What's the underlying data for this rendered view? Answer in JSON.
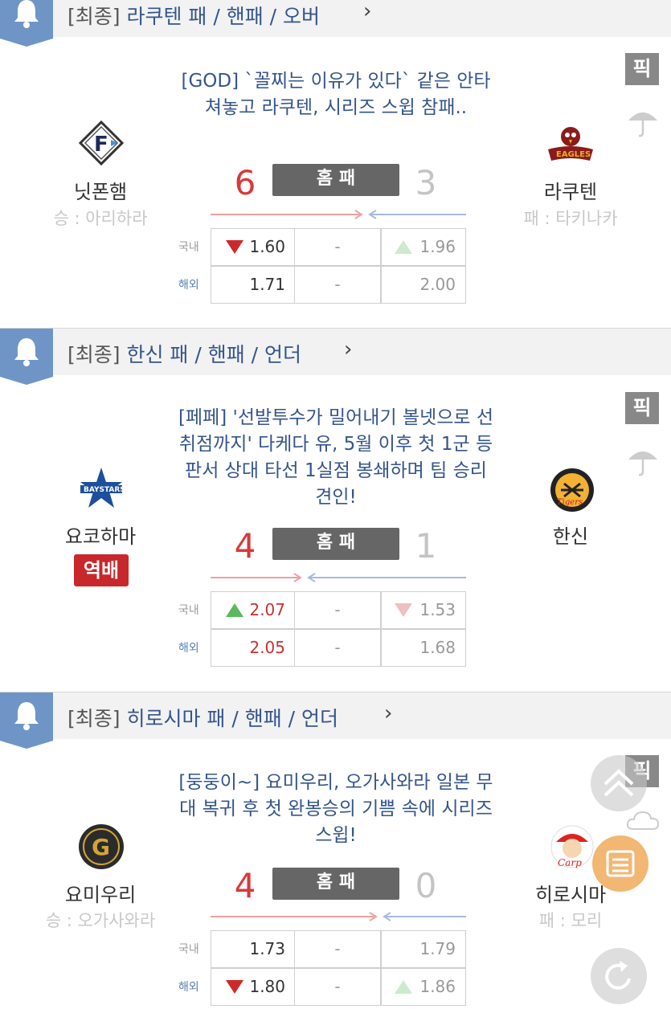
{
  "games": [
    {
      "header": {
        "prefix": "[최종]",
        "text": " 라쿠텐 패 / 핸패 / 오버",
        "chevron": "›"
      },
      "pick_label": "픽",
      "weather_icon": "umbrella-icon",
      "comment": "[GOD] `꼴찌는 이유가 있다` 같은 안타쳐놓고 라쿠텐, 시리즈 스윕 참패..",
      "home": {
        "name": "닛폰햄",
        "pitcher": "승 : 아리하라",
        "score": "6",
        "logo_icon": "fighters-logo"
      },
      "away": {
        "name": "라쿠텐",
        "pitcher": "패 : 타키나카",
        "score": "3",
        "logo_icon": "eagles-logo"
      },
      "status": "홈 패",
      "odds": [
        {
          "label": "국내",
          "home": "1.60",
          "draw": "-",
          "away": "1.96",
          "home_trend": "down",
          "away_trend": "up"
        },
        {
          "label": "해외",
          "home": "1.71",
          "draw": "-",
          "away": "2.00"
        }
      ]
    },
    {
      "header": {
        "prefix": "[최종]",
        "text": " 한신 패 / 핸패 / 언더",
        "chevron": "›"
      },
      "pick_label": "픽",
      "weather_icon": "umbrella-icon",
      "comment": "[페페] '선발투수가 밀어내기 볼넷으로 선취점까지' 다케다 유, 5월 이후 첫 1군 등판서 상대 타선 1실점 봉쇄하며 팀 승리 견인!",
      "home": {
        "name": "요코하마",
        "badge": "역배",
        "score": "4",
        "logo_icon": "baystars-logo"
      },
      "away": {
        "name": "한신",
        "score": "1",
        "logo_icon": "tigers-logo"
      },
      "status": "홈 패",
      "odds": [
        {
          "label": "국내",
          "home": "2.07",
          "draw": "-",
          "away": "1.53",
          "home_trend": "up",
          "away_trend": "down"
        },
        {
          "label": "해외",
          "home": "2.05",
          "draw": "-",
          "away": "1.68"
        }
      ]
    },
    {
      "header": {
        "prefix": "[최종]",
        "text": " 히로시마 패 / 핸패 / 언더",
        "chevron": "›"
      },
      "pick_label": "픽",
      "weather_icon": "cloud-icon",
      "comment": "[둥둥이~] 요미우리, 오가사와라 일본 무대 복귀 후 첫 완봉승의 기쁨 속에 시리즈 스윕!",
      "home": {
        "name": "요미우리",
        "pitcher": "승 : 오가사와라",
        "score": "4",
        "logo_icon": "giants-logo"
      },
      "away": {
        "name": "히로시마",
        "pitcher": "패 : 모리",
        "score": "0",
        "logo_icon": "carp-logo"
      },
      "status": "홈 패",
      "odds": [
        {
          "label": "국내",
          "home": "1.73",
          "draw": "-",
          "away": "1.79"
        },
        {
          "label": "해외",
          "home": "1.80",
          "draw": "-",
          "away": "1.86",
          "home_trend": "down",
          "away_trend": "up"
        }
      ]
    }
  ],
  "colors": {
    "accent_blue": "#34558b",
    "win_red": "#d9383a",
    "status_gray": "#666666",
    "badge_red": "#c8282b"
  }
}
